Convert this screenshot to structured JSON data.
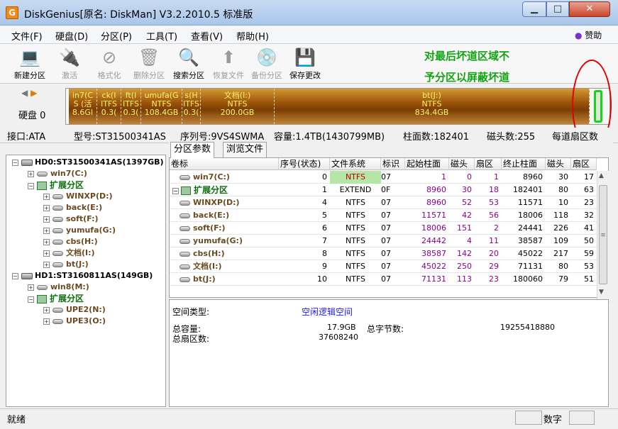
{
  "window": {
    "title": "DiskGenius[原名: DiskMan] V3.2.2010.5 标准版",
    "app_icon": "G",
    "controls": [
      "▁",
      "□",
      "✕"
    ]
  },
  "menu": [
    "文件(F)",
    "硬盘(D)",
    "分区(P)",
    "工具(T)",
    "查看(V)",
    "帮助(H)"
  ],
  "sponsor": "赞助",
  "toolbar": [
    {
      "label": "新建分区",
      "icon": "new-partition-icon",
      "enabled": true
    },
    {
      "label": "激活",
      "icon": "activate-icon",
      "enabled": false
    },
    {
      "label": "格式化",
      "icon": "format-icon",
      "enabled": false
    },
    {
      "label": "删除分区",
      "icon": "delete-partition-icon",
      "enabled": false
    },
    {
      "label": "搜索分区",
      "icon": "search-partition-icon",
      "enabled": true
    },
    {
      "label": "恢复文件",
      "icon": "recover-files-icon",
      "enabled": false
    },
    {
      "label": "备份分区",
      "icon": "backup-partition-icon",
      "enabled": false
    },
    {
      "label": "保存更改",
      "icon": "save-changes-icon",
      "enabled": true
    }
  ],
  "annotation": [
    "对最后坏道区域不",
    "予分区以屏蔽坏道"
  ],
  "disk_bar": {
    "label": "硬盘 0",
    "segments": [
      {
        "line1": "in7(C",
        "line2": "S (活",
        "line3": "8.6GI"
      },
      {
        "line1": "ck(I",
        "line2": "ITFS",
        "line3": "0.3("
      },
      {
        "line1": "ft(I",
        "line2": "ITFS",
        "line3": "0.3("
      },
      {
        "line1": "umufa(G",
        "line2": "NTFS",
        "line3": "108.4GB"
      },
      {
        "line1": "s(H",
        "line2": "ITFS",
        "line3": "0.3("
      },
      {
        "line1": "文档(I:)",
        "line2": "NTFS",
        "line3": "200.0GB"
      },
      {
        "line1": "bt(J:)",
        "line2": "NTFS",
        "line3": "834.4GB"
      }
    ]
  },
  "disk_info": {
    "interface": "接口:ATA",
    "model": "型号:ST31500341AS",
    "serial": "序列号:9VS4SWMA",
    "capacity": "容量:1.4TB(1430799MB)",
    "cylinders": "柱面数:182401",
    "heads": "磁头数:255",
    "sectors": "每道扇区数"
  },
  "tree": [
    {
      "level": 0,
      "kind": "hdd",
      "text": "HD0:ST31500341AS(1397GB)",
      "pm": "−"
    },
    {
      "level": 1,
      "kind": "part",
      "text": "win7(C:)",
      "pm": "+"
    },
    {
      "level": 1,
      "kind": "ext",
      "text": "扩展分区",
      "pm": "−"
    },
    {
      "level": 2,
      "kind": "part",
      "text": "WINXP(D:)",
      "pm": "+"
    },
    {
      "level": 2,
      "kind": "part",
      "text": "back(E:)",
      "pm": "+"
    },
    {
      "level": 2,
      "kind": "part",
      "text": "soft(F:)",
      "pm": "+"
    },
    {
      "level": 2,
      "kind": "part",
      "text": "yumufa(G:)",
      "pm": "+"
    },
    {
      "level": 2,
      "kind": "part",
      "text": "cbs(H:)",
      "pm": "+"
    },
    {
      "level": 2,
      "kind": "part",
      "text": "文档(I:)",
      "pm": "+"
    },
    {
      "level": 2,
      "kind": "part",
      "text": "bt(J:)",
      "pm": "+"
    },
    {
      "level": 0,
      "kind": "hdd",
      "text": "HD1:ST3160811AS(149GB)",
      "pm": "−"
    },
    {
      "level": 1,
      "kind": "part",
      "text": "win8(M:)",
      "pm": "+"
    },
    {
      "level": 1,
      "kind": "ext",
      "text": "扩展分区",
      "pm": "−"
    },
    {
      "level": 2,
      "kind": "part",
      "text": "UPE2(N:)",
      "pm": "+"
    },
    {
      "level": 2,
      "kind": "part",
      "text": "UPE3(O:)",
      "pm": "+"
    }
  ],
  "tabs": [
    "分区参数",
    "浏览文件"
  ],
  "table": {
    "headers": [
      "卷标",
      "序号(状态)",
      "文件系统",
      "标识",
      "起始柱面",
      "磁头",
      "扇区",
      "终止柱面",
      "磁头",
      "扇区"
    ],
    "rows": [
      {
        "label": "win7(C:)",
        "ext": false,
        "cells": [
          "0",
          "NTFS",
          "07",
          "1",
          "0",
          "1",
          "8960",
          "30",
          "17"
        ],
        "hi": true
      },
      {
        "label": "扩展分区",
        "ext": true,
        "cells": [
          "1",
          "EXTEND",
          "0F",
          "8960",
          "30",
          "18",
          "182401",
          "80",
          "63"
        ],
        "hi": false
      },
      {
        "label": "WINXP(D:)",
        "ext": false,
        "cells": [
          "4",
          "NTFS",
          "07",
          "8960",
          "52",
          "53",
          "11571",
          "10",
          "23"
        ],
        "hi": false
      },
      {
        "label": "back(E:)",
        "ext": false,
        "cells": [
          "5",
          "NTFS",
          "07",
          "11571",
          "42",
          "56",
          "18006",
          "118",
          "32"
        ],
        "hi": false
      },
      {
        "label": "soft(F:)",
        "ext": false,
        "cells": [
          "6",
          "NTFS",
          "07",
          "18006",
          "151",
          "2",
          "24441",
          "226",
          "41"
        ],
        "hi": false
      },
      {
        "label": "yumufa(G:)",
        "ext": false,
        "cells": [
          "7",
          "NTFS",
          "07",
          "24442",
          "4",
          "11",
          "38587",
          "109",
          "50"
        ],
        "hi": false
      },
      {
        "label": "cbs(H:)",
        "ext": false,
        "cells": [
          "8",
          "NTFS",
          "07",
          "38587",
          "142",
          "20",
          "45022",
          "217",
          "59"
        ],
        "hi": false
      },
      {
        "label": "文档(I:)",
        "ext": false,
        "cells": [
          "9",
          "NTFS",
          "07",
          "45022",
          "250",
          "29",
          "71131",
          "80",
          "53"
        ],
        "hi": false
      },
      {
        "label": "bt(J:)",
        "ext": false,
        "cells": [
          "10",
          "NTFS",
          "07",
          "71131",
          "113",
          "23",
          "180060",
          "79",
          "51"
        ],
        "hi": false
      }
    ]
  },
  "detail": {
    "space_type_label": "空间类型:",
    "space_type_value": "空闲逻辑空间",
    "total_capacity_label": "总容量:",
    "total_capacity_value": "17.9GB",
    "total_bytes_label": "总字节数:",
    "total_bytes_value": "19255418880",
    "total_sectors_label": "总扇区数:",
    "total_sectors_value": "37608240"
  },
  "status": {
    "text": "就绪",
    "num": "数字"
  },
  "scroll": {
    "arrow_up": "▲",
    "arrow_down": "▼",
    "arrow_left": "◀",
    "arrow_right": "▶",
    "grip": "|||",
    "vgrip": "≡"
  }
}
